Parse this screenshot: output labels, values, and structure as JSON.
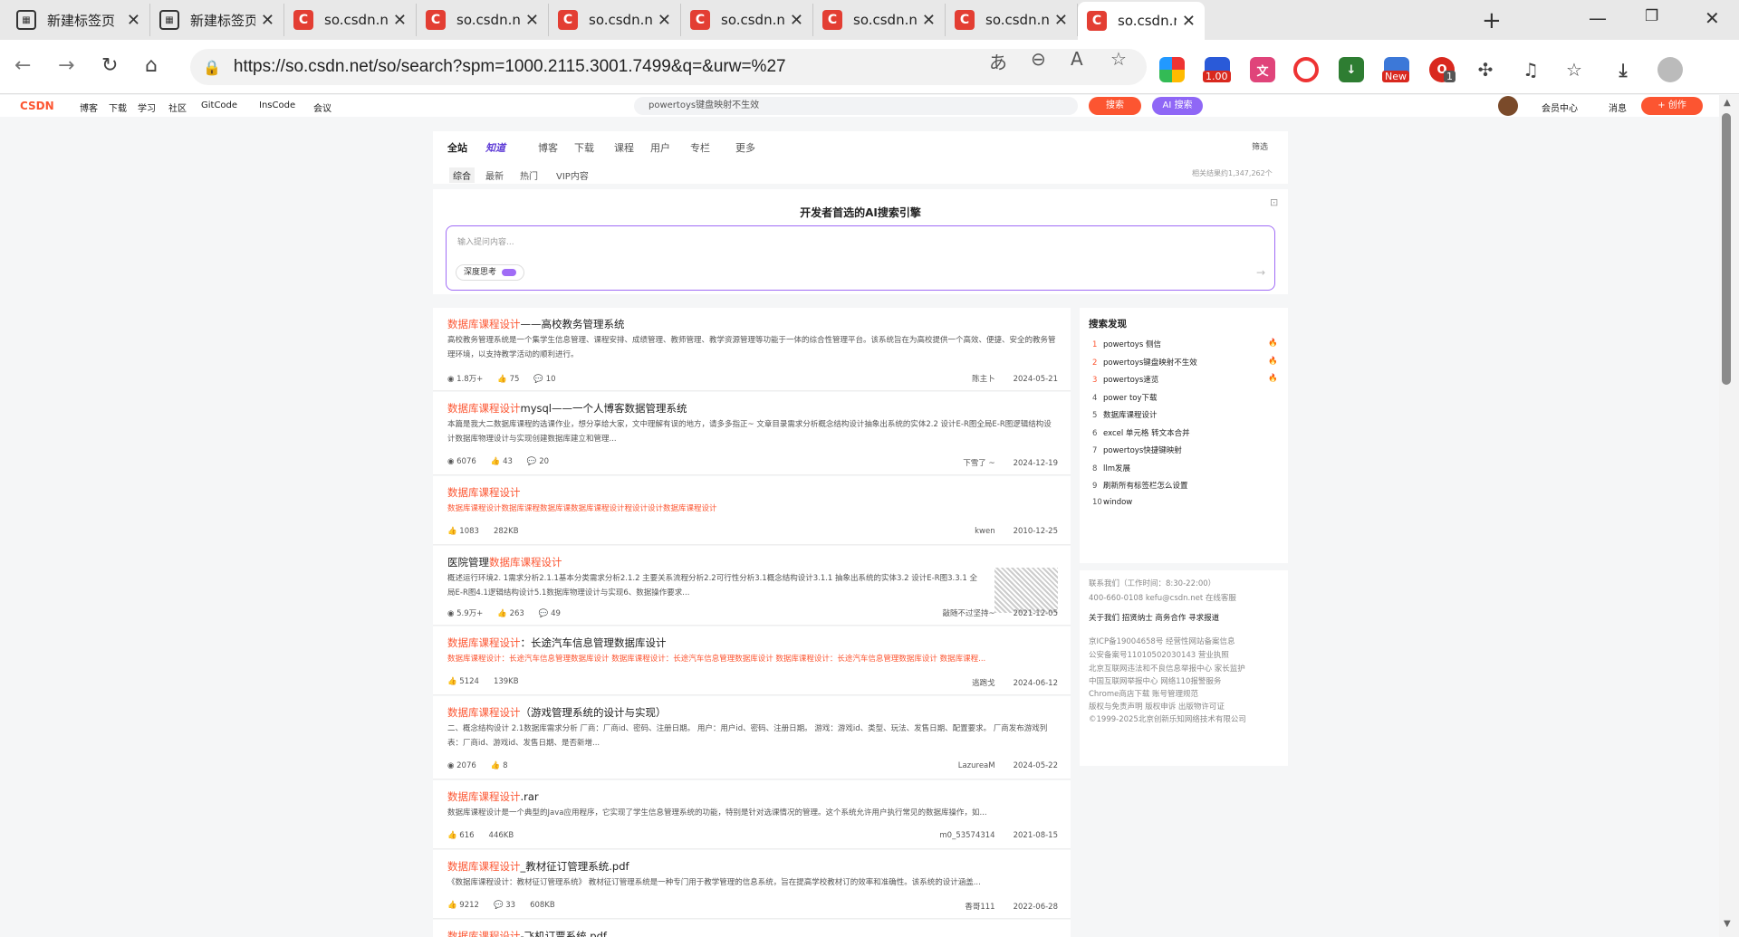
{
  "tabs": [
    {
      "title": "新建标签页",
      "type": "newtab"
    },
    {
      "title": "新建标签页",
      "type": "newtab"
    },
    {
      "title": "so.csdn.net/s",
      "type": "csdn"
    },
    {
      "title": "so.csdn.net/s",
      "type": "csdn"
    },
    {
      "title": "so.csdn.net/s",
      "type": "csdn"
    },
    {
      "title": "so.csdn.net/s",
      "type": "csdn"
    },
    {
      "title": "so.csdn.net/s",
      "type": "csdn"
    },
    {
      "title": "so.csdn.net/s",
      "type": "csdn"
    },
    {
      "title": "so.csdn.net/s",
      "type": "csdn",
      "active": true
    }
  ],
  "address": {
    "url": "https://so.csdn.net/so/search?spm=1000.2115.3001.7499&q=&urw=%27"
  },
  "extensions": {
    "badge_100": "1.00",
    "badge_new": "New",
    "badge_1": "1"
  },
  "csdn_header": {
    "logo": "CSDN",
    "nav": [
      "博客",
      "下载",
      "学习",
      "社区",
      "GitCode",
      "InsCode",
      "会议"
    ],
    "search_placeholder": "powertoys键盘映射不生效",
    "search_btn": "搜索",
    "ai_btn": "AI 搜索",
    "vip": "会员中心",
    "msg": "消息",
    "create": "创作"
  },
  "filter": {
    "tabs": [
      "全站",
      "知道",
      "博客",
      "下载",
      "课程",
      "用户",
      "专栏",
      "更多"
    ],
    "filter_label": "筛选",
    "subtabs": [
      "综合",
      "最新",
      "热门",
      "VIP内容"
    ],
    "count": "相关结果约1,347,262个"
  },
  "ai": {
    "title": "开发者首选的AI搜索引擎",
    "placeholder": "输入提问内容...",
    "deep": "深度思考"
  },
  "results": [
    {
      "title_hl": "数据库课程设计",
      "title_rest": "——高校教务管理系统",
      "desc": "高校教务管理系统是一个集学生信息管理、课程安排、成绩管理、教师管理、教学资源管理等功能于一体的综合性管理平台。该系统旨在为高校提供一个高效、便捷、安全的教务管理环境，以支持教学活动的顺利进行。",
      "views": "1.8万+",
      "likes": "75",
      "comments": "10",
      "author": "陈主卜",
      "date": "2024-05-21"
    },
    {
      "title_hl": "数据库课程设计",
      "title_rest": "mysql——一个人博客数据管理系统",
      "desc": "本篇是我大二数据库课程的选课作业，想分享给大家，文中理解有误的地方，请多多指正~ 文章目录需求分析概念结构设计抽象出系统的实体2.2 设计E-R图全局E-R图逻辑结构设计数据库物理设计与实现创建数据库建立和管理...",
      "views": "6076",
      "likes": "43",
      "comments": "20",
      "author": "下雪了 ~",
      "date": "2024-12-19"
    },
    {
      "title_hl": "数据库课程设计",
      "title_rest": "",
      "desc": "数据库课程设计数据库课程数据库课数据库课程设计程设计设计数据库课程设计",
      "likes": "1083",
      "size": "282KB",
      "author": "kwen",
      "date": "2010-12-25"
    },
    {
      "title_pre": "医院管理",
      "title_hl": "数据库课程设计",
      "title_rest": "",
      "desc": "概述运行环境2. 1需求分析2.1.1基本分类需求分析2.1.2 主要关系流程分析2.2可行性分析3.1概念结构设计3.1.1 抽象出系统的实体3.2 设计E-R图3.3.1 全局E-R图4.1逻辑结构设计5.1数据库物理设计与实现6、数据操作要求...",
      "views": "5.9万+",
      "likes": "263",
      "comments": "49",
      "author": "敲随不过坚持~",
      "date": "2021-12-05"
    },
    {
      "title_hl": "数据库课程设计",
      "title_rest": "：长途汽车信息管理数据库设计",
      "desc": "数据库课程设计：长途汽车信息管理数据库设计 数据库课程设计：长途汽车信息管理数据库设计 数据库课程设计：长途汽车信息管理数据库设计 数据库课程...",
      "likes": "5124",
      "size": "139KB",
      "author": "逃跑戈",
      "date": "2024-06-12"
    },
    {
      "title_hl": "数据库课程设计",
      "title_rest": "（游戏管理系统的设计与实现）",
      "desc": "二、概念结构设计 2.1数据库需求分析 厂商：厂商id、密码、注册日期。 用户：用户id、密码、注册日期。 游戏：游戏id、类型、玩法、发售日期、配置要求。 厂商发布游戏列表：厂商id、游戏id、发售日期、是否新增...",
      "views": "2076",
      "likes": "8",
      "author": "LazureaM",
      "date": "2024-05-22"
    },
    {
      "title_hl": "数据库课程设计",
      "title_rest": ".rar",
      "desc": "数据库课程设计是一个典型的Java应用程序，它实现了学生信息管理系统的功能，特别是针对选课情况的管理。这个系统允许用户执行常见的数据库操作，如...",
      "likes": "616",
      "size": "446KB",
      "author": "m0_53574314",
      "date": "2021-08-15"
    },
    {
      "title_hl": "数据库课程设计",
      "title_rest": "_教材征订管理系统.pdf",
      "desc": "《数据库课程设计：教材征订管理系统》 教材征订管理系统是一种专门用于教学管理的信息系统，旨在提高学校教材订的效率和准确性。该系统的设计涵盖...",
      "likes": "9212",
      "comments": "33",
      "size": "608KB",
      "author": "香哥111",
      "date": "2022-06-28"
    },
    {
      "title_hl": "数据库课程设计",
      "title_rest": "-飞机订票系统.pdf",
      "desc": ""
    }
  ],
  "hot": {
    "title": "搜索发现",
    "items": [
      {
        "n": "1",
        "text": "powertoys 侧信",
        "fire": true
      },
      {
        "n": "2",
        "text": "powertoys键盘映射不生效",
        "fire": true
      },
      {
        "n": "3",
        "text": "powertoys速览",
        "fire": true
      },
      {
        "n": "4",
        "text": "power toy下载"
      },
      {
        "n": "5",
        "text": "数据库课程设计"
      },
      {
        "n": "6",
        "text": "excel 单元格 转文本合并"
      },
      {
        "n": "7",
        "text": "powertoys快捷键映射"
      },
      {
        "n": "8",
        "text": "llm发展"
      },
      {
        "n": "9",
        "text": "刷新所有标签栏怎么设置"
      },
      {
        "n": "10",
        "text": "window"
      }
    ]
  },
  "footer": {
    "lines": [
      "联系我们（工作时间：8:30-22:00）",
      "400-660-0108   kefu@csdn.net   在线客服",
      "关于我们   招贤纳士   商务合作   寻求报道",
      "京ICP备19004658号   经营性网站备案信息",
      "公安备案号11010502030143   营业执照",
      "北京互联网违法和不良信息举报中心   家长监护",
      "中国互联网举报中心   网络110报警服务",
      "Chrome商店下载   账号管理规范",
      "版权与免责声明   版权申诉   出版物许可证",
      "©1999-2025北京创新乐知网络技术有限公司"
    ]
  }
}
